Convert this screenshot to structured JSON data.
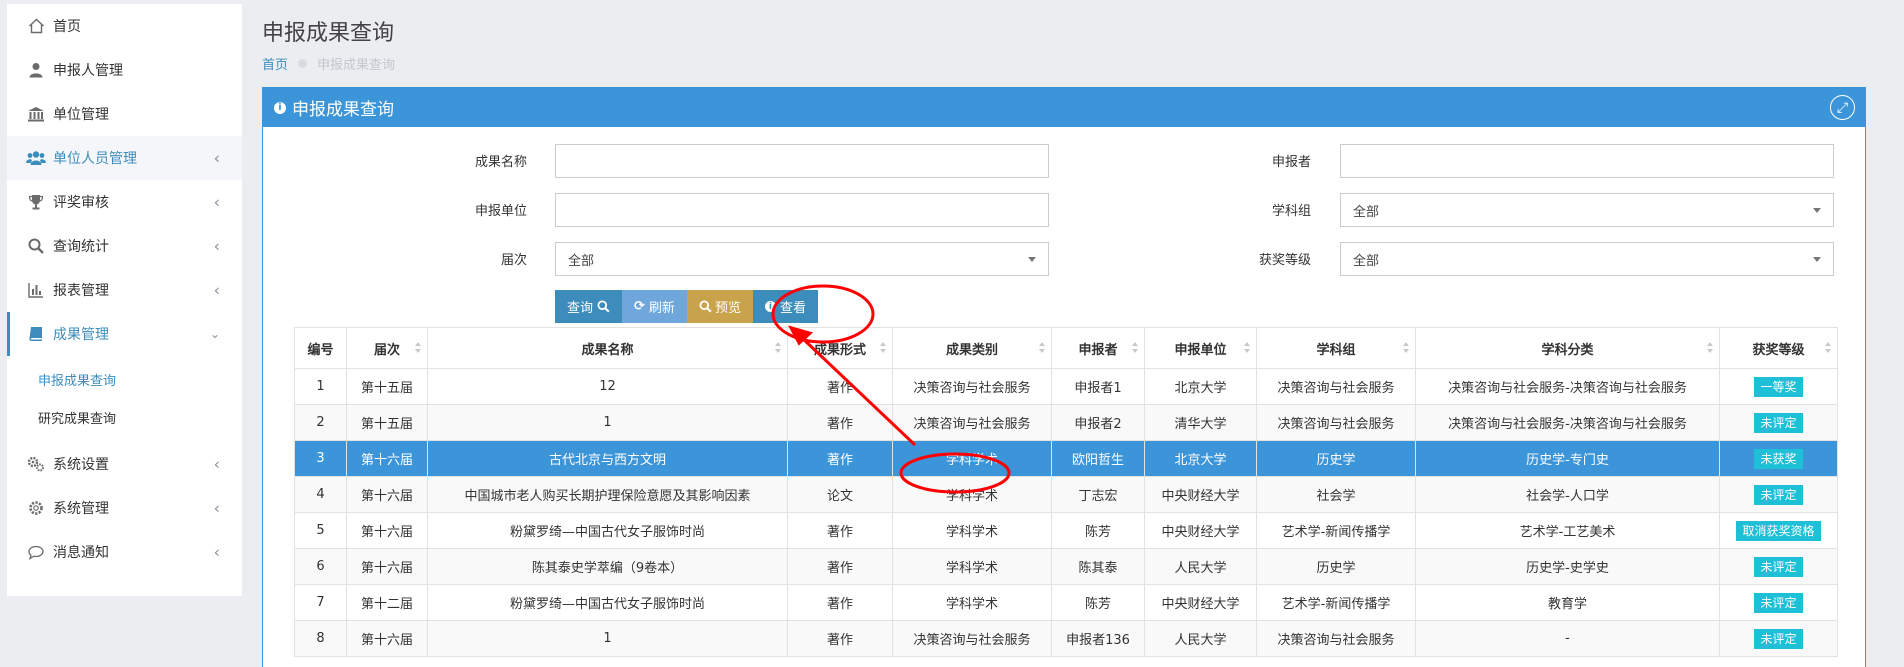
{
  "sidebar": {
    "items": [
      {
        "label": "首页",
        "icon": "home-icon"
      },
      {
        "label": "申报人管理",
        "icon": "user-icon"
      },
      {
        "label": "单位管理",
        "icon": "institution-icon"
      },
      {
        "label": "单位人员管理",
        "icon": "users-icon"
      },
      {
        "label": "评奖审核",
        "icon": "trophy-icon"
      },
      {
        "label": "查询统计",
        "icon": "search-icon"
      },
      {
        "label": "报表管理",
        "icon": "bar-chart-icon"
      },
      {
        "label": "成果管理",
        "icon": "book-icon"
      },
      {
        "label": "系统设置",
        "icon": "gears-icon"
      },
      {
        "label": "系统管理",
        "icon": "gear-icon"
      },
      {
        "label": "消息通知",
        "icon": "comment-icon"
      }
    ],
    "sub_items": [
      "申报成果查询",
      "研究成果查询"
    ]
  },
  "header": {
    "title": "申报成果查询",
    "breadcrumb_home": "首页",
    "breadcrumb_current": "申报成果查询"
  },
  "panel": {
    "title": "申报成果查询"
  },
  "form": {
    "name_label": "成果名称",
    "name_value": "",
    "applicant_label": "申报者",
    "applicant_value": "",
    "unit_label": "申报单位",
    "unit_value": "",
    "group_label": "学科组",
    "group_value": "全部",
    "session_label": "届次",
    "session_value": "全部",
    "award_label": "获奖等级",
    "award_value": "全部"
  },
  "buttons": {
    "query": "查询",
    "refresh": "刷新",
    "preview": "预览",
    "view": "查看"
  },
  "table": {
    "headers": [
      "编号",
      "届次",
      "成果名称",
      "成果形式",
      "成果类别",
      "申报者",
      "申报单位",
      "学科组",
      "学科分类",
      "获奖等级"
    ],
    "rows": [
      [
        "1",
        "第十五届",
        "12",
        "著作",
        "决策咨询与社会服务",
        "申报者1",
        "北京大学",
        "决策咨询与社会服务",
        "决策咨询与社会服务-决策咨询与社会服务",
        "一等奖"
      ],
      [
        "2",
        "第十五届",
        "1",
        "著作",
        "决策咨询与社会服务",
        "申报者2",
        "清华大学",
        "决策咨询与社会服务",
        "决策咨询与社会服务-决策咨询与社会服务",
        "未评定"
      ],
      [
        "3",
        "第十六届",
        "古代北京与西方文明",
        "著作",
        "学科学术",
        "欧阳哲生",
        "北京大学",
        "历史学",
        "历史学-专门史",
        "未获奖"
      ],
      [
        "4",
        "第十六届",
        "中国城市老人购买长期护理保险意愿及其影响因素",
        "论文",
        "学科学术",
        "丁志宏",
        "中央财经大学",
        "社会学",
        "社会学-人口学",
        "未评定"
      ],
      [
        "5",
        "第十六届",
        "粉黛罗绮—中国古代女子服饰时尚",
        "著作",
        "学科学术",
        "陈芳",
        "中央财经大学",
        "艺术学-新闻传播学",
        "艺术学-工艺美术",
        "取消获奖资格"
      ],
      [
        "6",
        "第十六届",
        "陈其泰史学萃编（9卷本）",
        "著作",
        "学科学术",
        "陈其泰",
        "人民大学",
        "历史学",
        "历史学-史学史",
        "未评定"
      ],
      [
        "7",
        "第十二届",
        "粉黛罗绮—中国古代女子服饰时尚",
        "著作",
        "学科学术",
        "陈芳",
        "中央财经大学",
        "艺术学-新闻传播学",
        "教育学",
        "未评定"
      ],
      [
        "8",
        "第十六届",
        "1",
        "著作",
        "决策咨询与社会服务",
        "申报者136",
        "人民大学",
        "决策咨询与社会服务",
        "-",
        "未评定"
      ]
    ],
    "selected_row": 3
  },
  "colors": {
    "primary": "#3c95d9",
    "badge": "#1ec0d7",
    "annotation": "#ff0000"
  }
}
